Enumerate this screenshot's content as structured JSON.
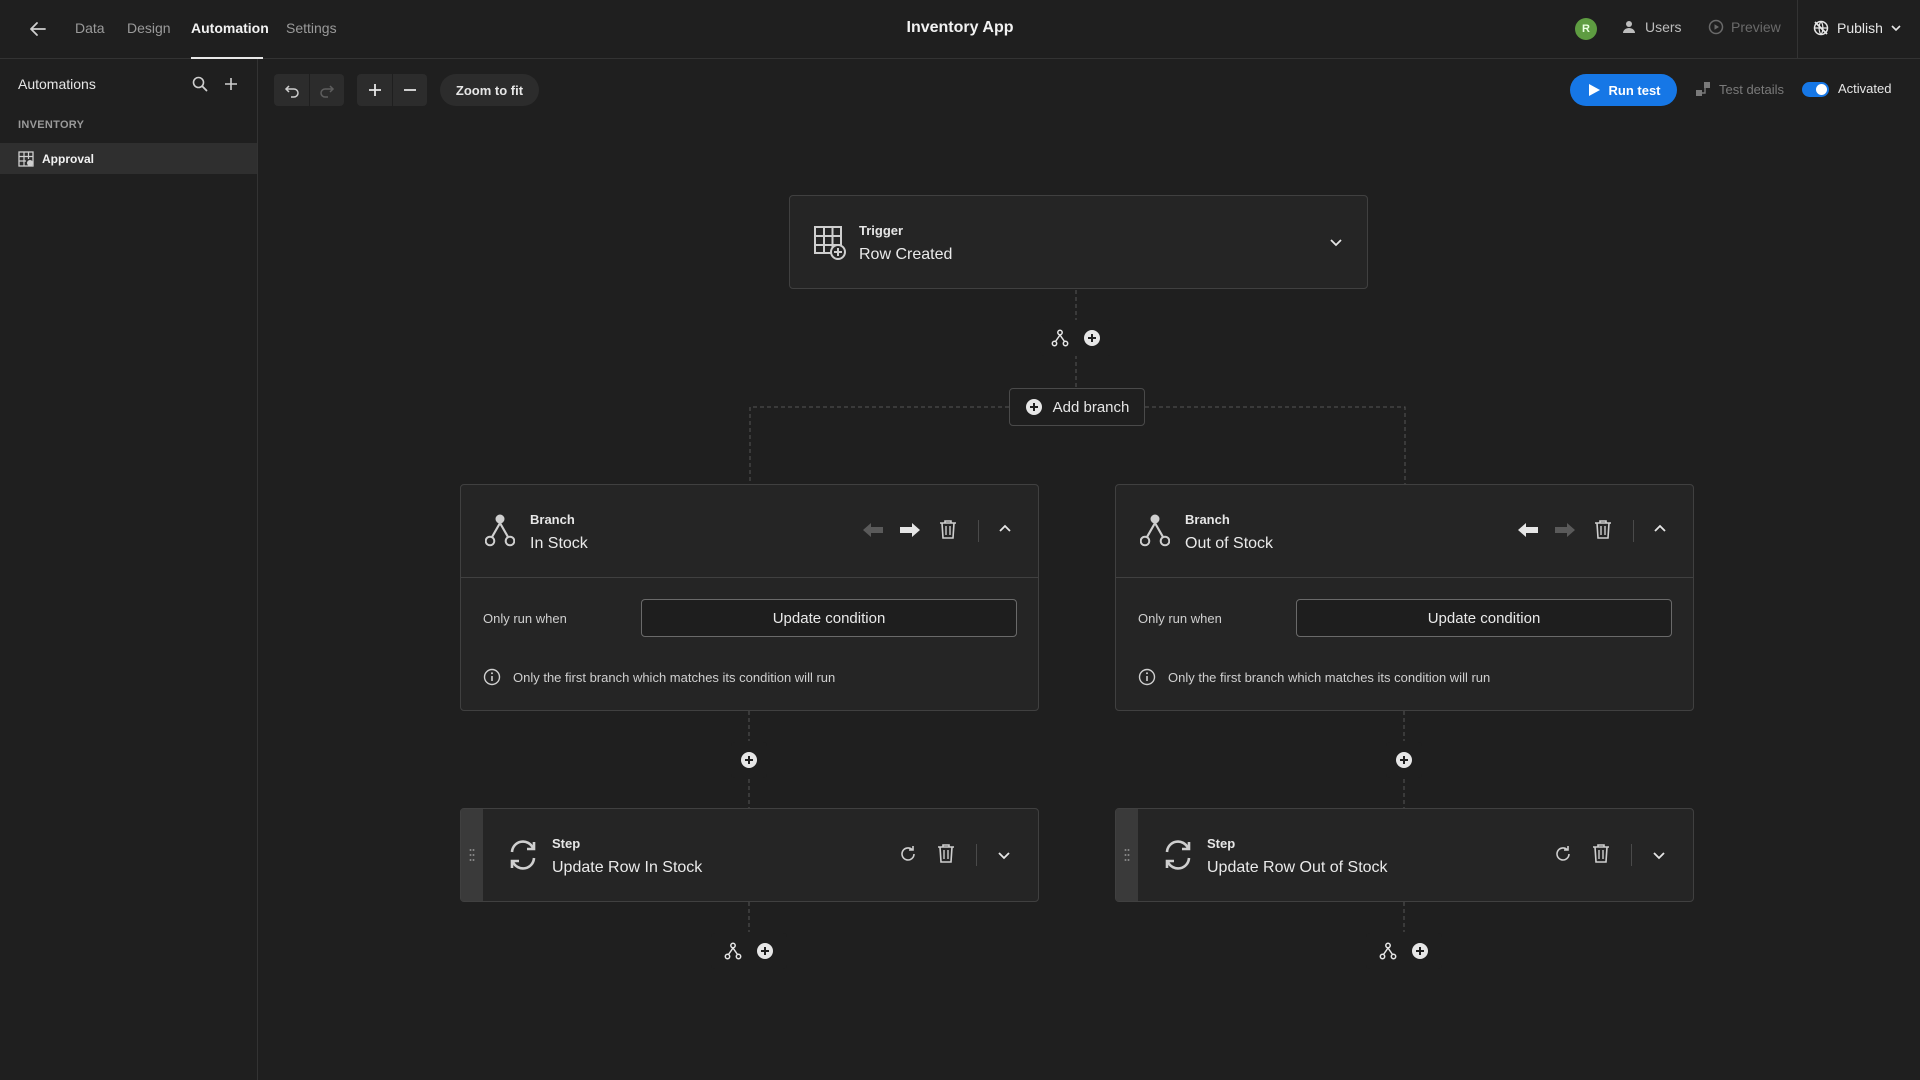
{
  "topbar": {
    "tabs": [
      "Data",
      "Design",
      "Automation",
      "Settings"
    ],
    "app_title": "Inventory App",
    "avatar_initial": "R",
    "users_label": "Users",
    "preview_label": "Preview",
    "publish_label": "Publish"
  },
  "sidebar": {
    "title": "Automations",
    "section": "INVENTORY",
    "items": [
      {
        "label": "Approval"
      }
    ]
  },
  "toolbar": {
    "zoom_fit_label": "Zoom to fit",
    "run_test_label": "Run test",
    "test_details_label": "Test details",
    "activated_label": "Activated",
    "activated": true
  },
  "flow": {
    "trigger": {
      "title": "Trigger",
      "name": "Row Created"
    },
    "add_branch_label": "Add branch",
    "branches": [
      {
        "title": "Branch",
        "name": "In Stock",
        "only_run_label": "Only run when",
        "condition_button": "Update condition",
        "info_text": "Only the first branch which matches its condition will run",
        "step": {
          "title": "Step",
          "name": "Update Row In Stock"
        }
      },
      {
        "title": "Branch",
        "name": "Out of Stock",
        "only_run_label": "Only run when",
        "condition_button": "Update condition",
        "info_text": "Only the first branch which matches its condition will run",
        "step": {
          "title": "Step",
          "name": "Update Row Out of Stock"
        }
      }
    ]
  },
  "colors": {
    "background": "#1f1f1f",
    "card": "#252525",
    "accent_blue": "#1677e6",
    "avatar_green": "#5e9c41"
  }
}
